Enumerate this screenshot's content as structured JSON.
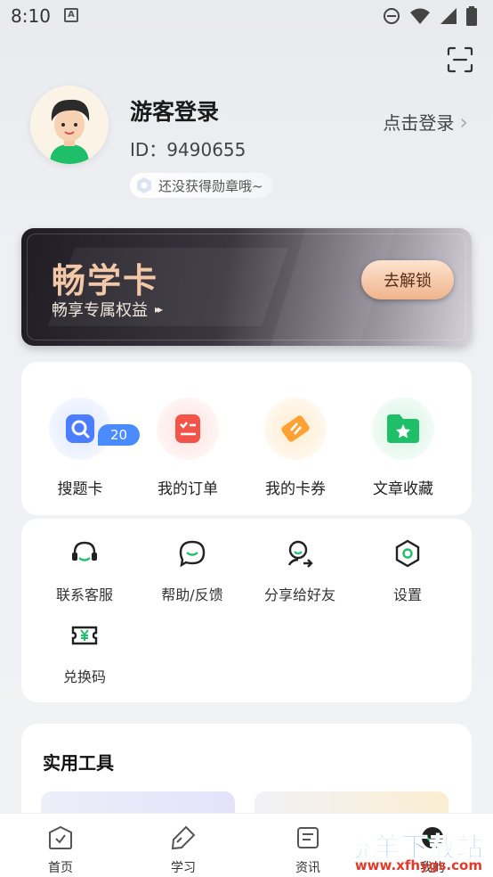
{
  "status_bar": {
    "time": "8:10",
    "notification_glyph": "A",
    "icons": [
      "minus-circle-icon",
      "wifi-icon",
      "signal-icon",
      "battery-icon"
    ]
  },
  "profile": {
    "username": "游客登录",
    "user_id": "ID：9490655",
    "badge_text": "还没获得勋章哦~",
    "login_link": "点击登录",
    "login_arrow": "›"
  },
  "vip_card": {
    "title": "畅学卡",
    "subtitle": "畅享专属权益",
    "subtitle_arrow": "▸▸",
    "button_label": "去解锁"
  },
  "quick_actions": [
    {
      "label": "搜题卡",
      "badge": "20",
      "icon": "search-card-icon",
      "color": "#4a7dff"
    },
    {
      "label": "我的订单",
      "icon": "order-list-icon",
      "color": "#f2544a"
    },
    {
      "label": "我的卡券",
      "icon": "coupon-icon",
      "color": "#ffa233"
    },
    {
      "label": "文章收藏",
      "icon": "star-folder-icon",
      "color": "#1fbf6a"
    }
  ],
  "services": [
    {
      "label": "联系客服",
      "icon": "headset-icon"
    },
    {
      "label": "帮助/反馈",
      "icon": "chat-bubble-icon"
    },
    {
      "label": "分享给好友",
      "icon": "share-user-icon"
    },
    {
      "label": "设置",
      "icon": "hexagon-gear-icon"
    },
    {
      "label": "兑换码",
      "icon": "yen-ticket-icon"
    }
  ],
  "tools": {
    "title": "实用工具"
  },
  "bottom_nav": [
    {
      "label": "首页",
      "icon": "home-check-icon"
    },
    {
      "label": "学习",
      "icon": "pencil-tag-icon"
    },
    {
      "label": "资讯",
      "icon": "news-icon"
    },
    {
      "label": "我的",
      "icon": "profile-icon"
    }
  ],
  "watermark": {
    "main": "晓羊下载站",
    "url": "www.xfhygs.com"
  },
  "colors": {
    "accent_green": "#1fbf6a",
    "gold": "#f0b48d",
    "blue": "#4a8cff"
  }
}
